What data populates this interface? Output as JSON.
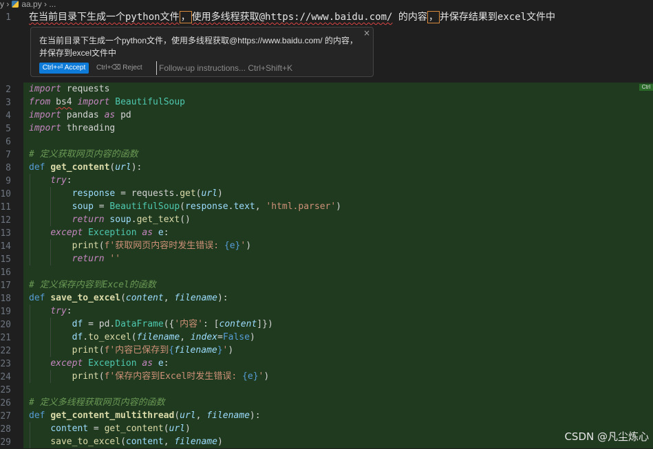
{
  "breadcrumb": {
    "prefix": "y",
    "file": "aa.py",
    "rest": "..."
  },
  "prompt": {
    "line_number": "1",
    "part1": "在当前目录下生成一个python文件",
    "part2": "，",
    "part3": "使用多线程获取@https://www.baidu.com/",
    "part4": " 的内容",
    "part5": "，",
    "part6": "并保存结果到excel文件中"
  },
  "widget": {
    "text_line1": "在当前目录下生成一个python文件，使用多线程获取@https://www.baidu.com/ 的内容，",
    "text_line2": "并保存到excel文件中",
    "accept_label": "Ctrl+⏎ Accept",
    "reject_label": "Ctrl+⌫ Reject",
    "followup_placeholder": "Follow-up instructions... Ctrl+Shift+K",
    "close_glyph": "×",
    "ctrl_badge": "Ctrl"
  },
  "code": {
    "line_numbers": [
      "2",
      "3",
      "4",
      "5",
      "6",
      "7",
      "8",
      "9",
      "10",
      "11",
      "12",
      "13",
      "14",
      "15",
      "16",
      "17",
      "18",
      "19",
      "20",
      "21",
      "22",
      "23",
      "24",
      "25",
      "26",
      "27",
      "28",
      "29"
    ],
    "l2_kw": "import",
    "l2_mod": " requests",
    "l3_kw": "from",
    "l3_mod": "bs4",
    "l3_kw2": "import",
    "l3_cls": "BeautifulSoup",
    "l4_kw": "import",
    "l4_mod": " pandas ",
    "l4_kw2": "as",
    "l4_alias": " pd",
    "l5_kw": "import",
    "l5_mod": " threading",
    "l7_cmt": "# 定义获取网页内容的函数",
    "l8_def": "def",
    "l8_fn": "get_content",
    "l8_p": "url",
    "l9_try": "try",
    "l10_a": "response",
    "l10_b": "requests",
    "l10_fn": "get",
    "l10_p": "url",
    "l11_a": "soup",
    "l11_cls": "BeautifulSoup",
    "l11_b": "response",
    "l11_c": "text",
    "l11_s": "'html.parser'",
    "l12_kw": "return",
    "l12_a": "soup",
    "l12_fn": "get_text",
    "l13_kw": "except",
    "l13_cls": "Exception",
    "l13_kw2": "as",
    "l13_e": "e",
    "l14_fn": "print",
    "l14_s1": "f'获取网页内容时发生错误: ",
    "l14_e": "{e}",
    "l14_s2": "'",
    "l15_kw": "return",
    "l15_s": "''",
    "l17_cmt": "# 定义保存内容到Excel的函数",
    "l18_def": "def",
    "l18_fn": "save_to_excel",
    "l18_p1": "content",
    "l18_p2": "filename",
    "l19_try": "try",
    "l20_a": "df",
    "l20_b": "pd",
    "l20_cls": "DataFrame",
    "l20_s": "'内容'",
    "l20_p": "content",
    "l21_a": "df",
    "l21_fn": "to_excel",
    "l21_p": "filename",
    "l21_k": "index",
    "l21_v": "False",
    "l22_fn": "print",
    "l22_s1": "f'内容已保存到",
    "l22_p": "filename",
    "l22_s2": "'",
    "l23_kw": "except",
    "l23_cls": "Exception",
    "l23_kw2": "as",
    "l23_e": "e",
    "l24_fn": "print",
    "l24_s1": "f'保存内容到Excel时发生错误: ",
    "l24_e": "{e}",
    "l24_s2": "'",
    "l26_cmt": "# 定义多线程获取网页内容的函数",
    "l27_def": "def",
    "l27_fn": "get_content_multithread",
    "l27_p1": "url",
    "l27_p2": "filename",
    "l28_a": "content",
    "l28_fn": "get_content",
    "l28_p": "url",
    "l29_fn": "save_to_excel",
    "l29_a": "content",
    "l29_p": "filename"
  },
  "watermark": "CSDN @凡尘炼心",
  "colors": {
    "diff_bg": "#203a1f",
    "accent": "#0e7bd8",
    "editor_bg": "#1f1f1f"
  }
}
